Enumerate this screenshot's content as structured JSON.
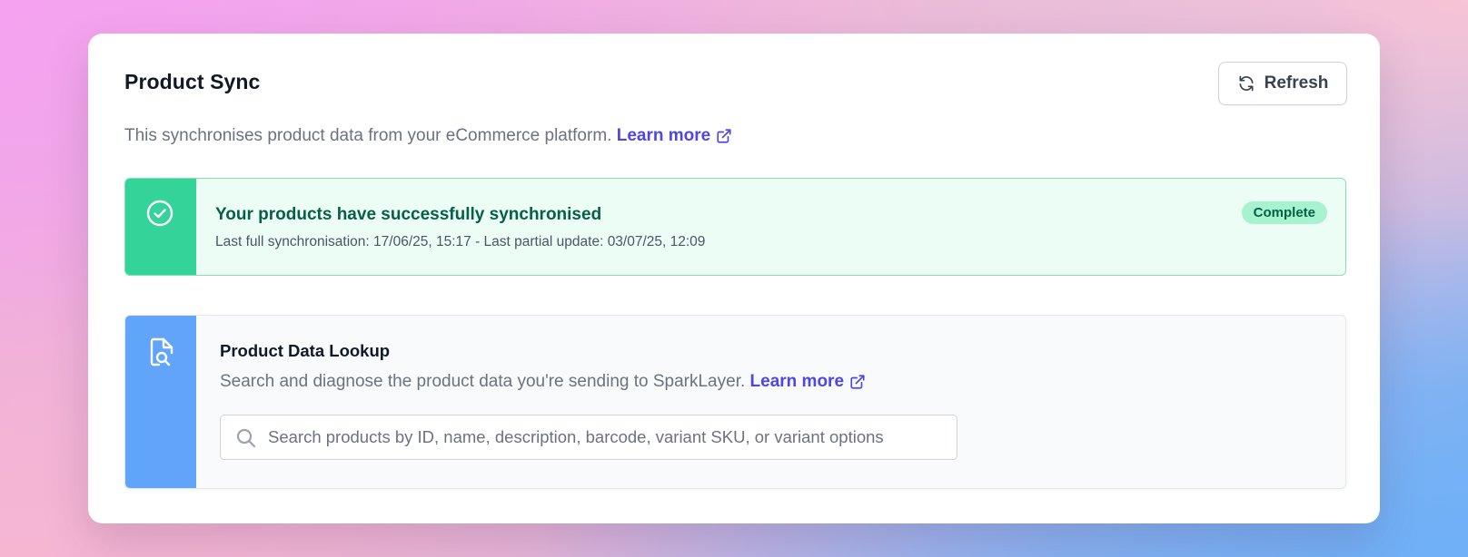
{
  "header": {
    "title": "Product Sync",
    "refresh_label": "Refresh"
  },
  "intro": {
    "text": "This synchronises product data from your eCommerce platform.",
    "link_label": "Learn more"
  },
  "status": {
    "title": "Your products have successfully synchronised",
    "subtitle": "Last full synchronisation: 17/06/25, 15:17 - Last partial update: 03/07/25, 12:09",
    "badge": "Complete",
    "icon": "check-circle-icon",
    "accent_color": "#34d399"
  },
  "lookup": {
    "title": "Product Data Lookup",
    "desc": "Search and diagnose the product data you're sending to SparkLayer.",
    "link_label": "Learn more",
    "icon": "document-search-icon",
    "accent_color": "#60a5fa",
    "search": {
      "placeholder": "Search products by ID, name, description, barcode, variant SKU, or variant options",
      "value": ""
    }
  },
  "colors": {
    "link": "#4f46e5",
    "success_bg": "#ecfdf5",
    "badge_bg": "#a7f3d0"
  }
}
